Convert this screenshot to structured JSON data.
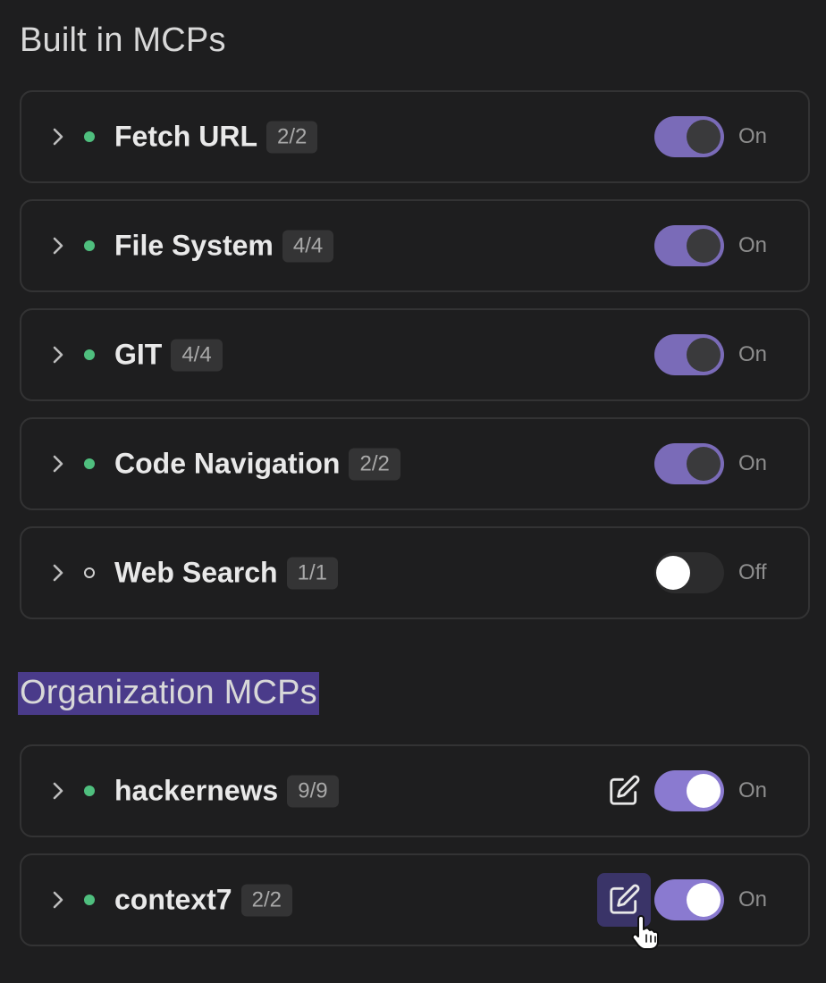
{
  "built_in": {
    "title": "Built in MCPs",
    "items": [
      {
        "name": "Fetch URL",
        "count": "2/2",
        "state": "On",
        "status": "active"
      },
      {
        "name": "File System",
        "count": "4/4",
        "state": "On",
        "status": "active"
      },
      {
        "name": "GIT",
        "count": "4/4",
        "state": "On",
        "status": "active"
      },
      {
        "name": "Code Navigation",
        "count": "2/2",
        "state": "On",
        "status": "active"
      },
      {
        "name": "Web Search",
        "count": "1/1",
        "state": "Off",
        "status": "inactive"
      }
    ]
  },
  "organization": {
    "title": "Organization MCPs",
    "items": [
      {
        "name": "hackernews",
        "count": "9/9",
        "state": "On",
        "status": "active"
      },
      {
        "name": "context7",
        "count": "2/2",
        "state": "On",
        "status": "active"
      }
    ]
  },
  "icons": {
    "expand": "chevron-right-icon",
    "active_status": "green-dot-icon",
    "inactive_status": "hollow-circle-icon",
    "edit": "edit-pencil-icon",
    "cursor": "hand-pointer-icon"
  },
  "colors": {
    "background": "#1e1e1f",
    "card_border": "#333334",
    "active_dot": "#4fbf7e",
    "toggle_on": "#7a6bb8",
    "toggle_on_bright": "#8a7ad0",
    "highlight": "#4a3b8a"
  }
}
